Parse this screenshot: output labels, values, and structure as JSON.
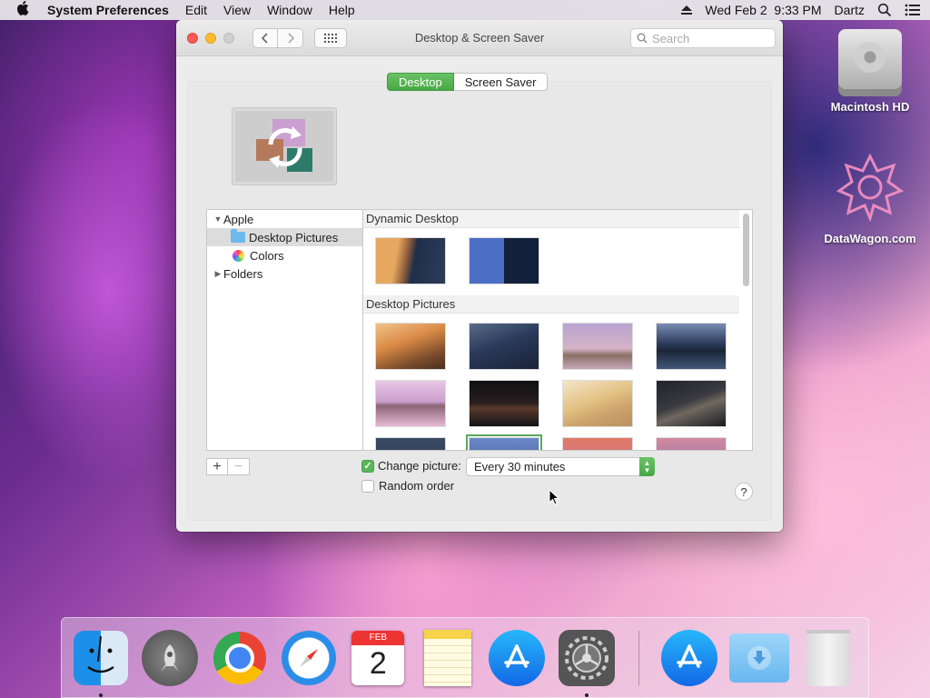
{
  "menubar": {
    "app_name": "System Preferences",
    "menus": [
      "Edit",
      "View",
      "Window",
      "Help"
    ],
    "clock": "Wed Feb 2  9:33 PM",
    "user": "Dartz"
  },
  "desktop_icons": {
    "hd_label": "Macintosh HD",
    "datawagon_label": "DataWagon.com"
  },
  "window": {
    "title": "Desktop & Screen Saver",
    "search_placeholder": "Search",
    "tabs": {
      "desktop": "Desktop",
      "screen_saver": "Screen Saver"
    },
    "source_list": {
      "apple": "Apple",
      "desktop_pictures": "Desktop Pictures",
      "colors": "Colors",
      "folders": "Folders"
    },
    "gallery": {
      "dynamic_header": "Dynamic Desktop",
      "pictures_header": "Desktop Pictures"
    },
    "change_picture_label": "Change picture:",
    "change_picture_checked": true,
    "interval": "Every 30 minutes",
    "random_order_label": "Random order",
    "random_order_checked": false,
    "help": "?"
  },
  "dock": {
    "calendar_month": "FEB",
    "calendar_day": "2",
    "items": [
      "Finder",
      "Launchpad",
      "Google Chrome",
      "Safari",
      "Calendar",
      "Notes",
      "App Store",
      "System Preferences",
      "App Store",
      "Downloads",
      "Trash"
    ]
  },
  "colors": {
    "accent_green": "#47a845",
    "close": "#fc5b57",
    "minimize": "#fdbc2e"
  }
}
